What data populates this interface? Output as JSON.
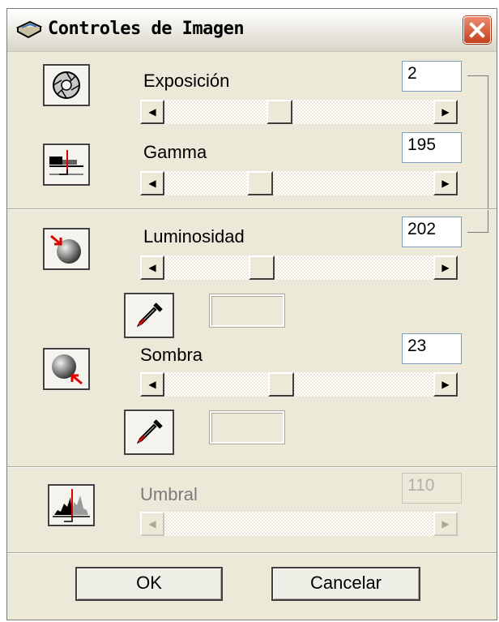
{
  "window": {
    "title": "Controles de Imagen"
  },
  "controls": {
    "exposicion": {
      "label": "Exposición",
      "value": "2",
      "slider_position": 0.43
    },
    "gamma": {
      "label": "Gamma",
      "value": "195",
      "slider_position": 0.4
    },
    "luminosidad": {
      "label": "Luminosidad",
      "value": "202",
      "slider_position": 0.41
    },
    "sombra": {
      "label": "Sombra",
      "value": "23",
      "slider_position": 0.43
    },
    "umbral": {
      "label": "Umbral",
      "value": "110",
      "enabled": false
    }
  },
  "buttons": {
    "ok": "OK",
    "cancel": "Cancelar"
  },
  "icons": {
    "title": "scanner-icon",
    "exposicion": "aperture-icon",
    "gamma": "gamma-curve-icon",
    "luminosidad": "highlight-sphere-icon",
    "sombra": "shadow-sphere-icon",
    "umbral": "histogram-icon",
    "eyedropper": "eyedropper-icon"
  },
  "colors": {
    "accent_red": "#e00000",
    "close_button": "#d3542f",
    "dialog_bg": "#ece9d8"
  }
}
